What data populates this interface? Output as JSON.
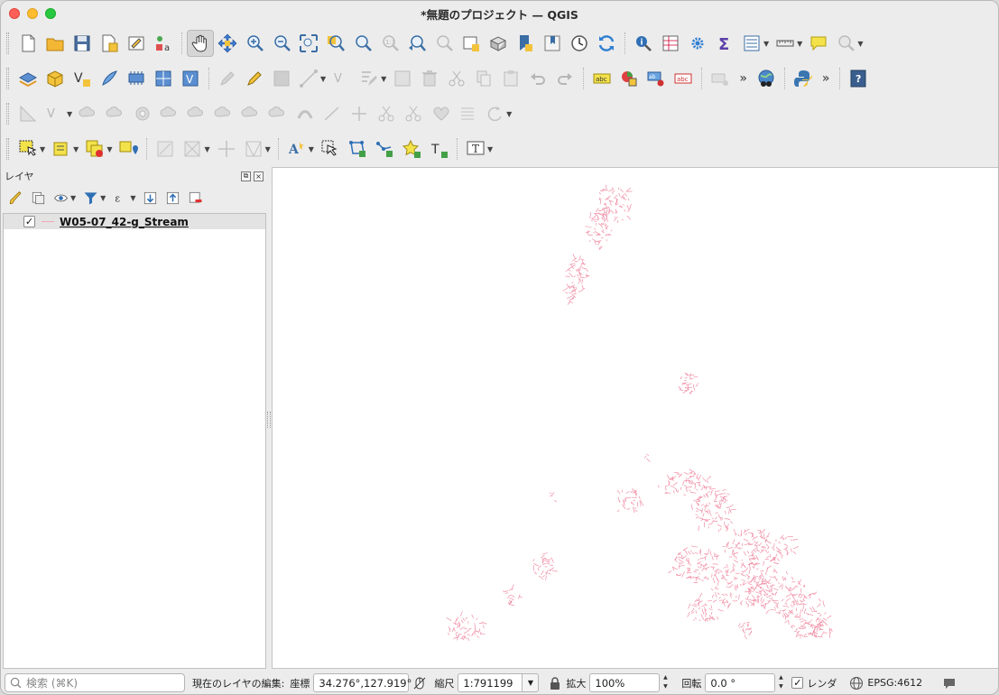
{
  "window": {
    "title": "*無題のプロジェクト — QGIS"
  },
  "layers_panel": {
    "title": "レイヤ",
    "float_label": "⧉",
    "close_label": "×",
    "layers": [
      {
        "name": "W05-07_42-g_Stream",
        "checked": "✓",
        "symbol_color": "#f4a8b6"
      }
    ]
  },
  "toolbars": {
    "overflow_label": "»"
  },
  "status": {
    "search_placeholder": "検索 (⌘K)",
    "edit_label": "現在のレイヤの編集:",
    "coord_label": "座標",
    "coord_value": "34.276°,127.919°",
    "scale_label": "縮尺",
    "scale_value": "1:791199",
    "magnify_label": "拡大",
    "magnify_value": "100%",
    "rotation_label": "回転",
    "rotation_value": "0.0 °",
    "render_label": "レンダ",
    "render_checked": "✓",
    "crs_label": "EPSG:4612"
  },
  "map": {
    "stream_color": "#f08ea4"
  }
}
